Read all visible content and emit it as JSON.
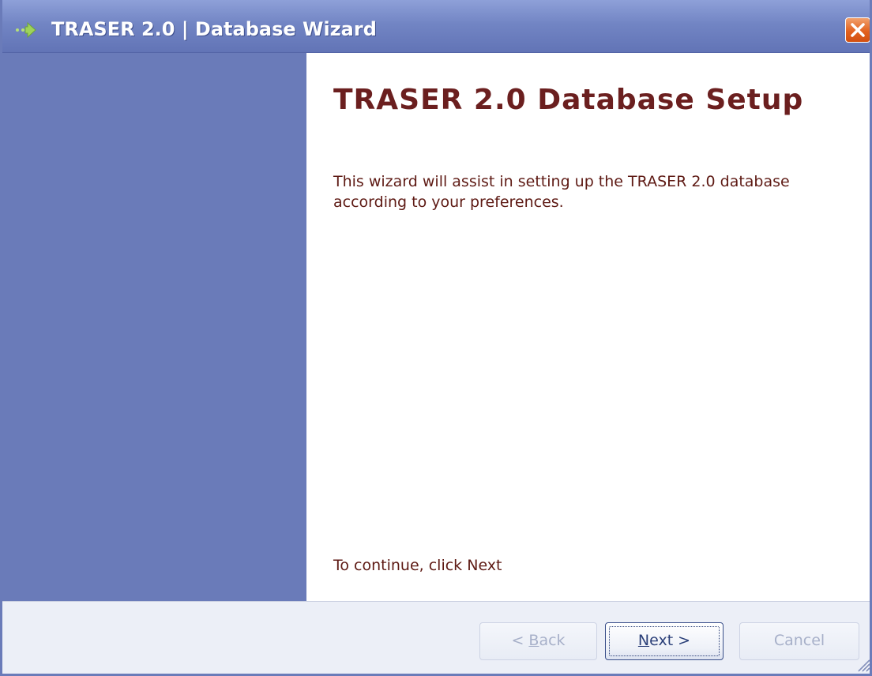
{
  "window": {
    "title": "TRASER 2.0 | Database Wizard"
  },
  "icons": {
    "title_icon": "arrow-right-icon",
    "close_icon": "close-icon",
    "grip_icon": "resize-grip-icon"
  },
  "content": {
    "heading": "TRASER 2.0 Database Setup",
    "description": "This wizard will assist in setting up the TRASER 2.0 database according to your preferences.",
    "continue_hint": "To continue, click Next"
  },
  "buttons": {
    "back": {
      "prefix": "< ",
      "mnemonic": "B",
      "rest": "ack",
      "enabled": false
    },
    "next": {
      "mnemonic": "N",
      "rest": "ext >",
      "enabled": true
    },
    "cancel": {
      "label": "Cancel",
      "enabled": false
    }
  },
  "colors": {
    "sidebar": "#6a7bb9",
    "heading": "#6b1f1f",
    "body_text": "#5e1a14",
    "footer": "#eceff7",
    "close_button": "#e2621f"
  }
}
